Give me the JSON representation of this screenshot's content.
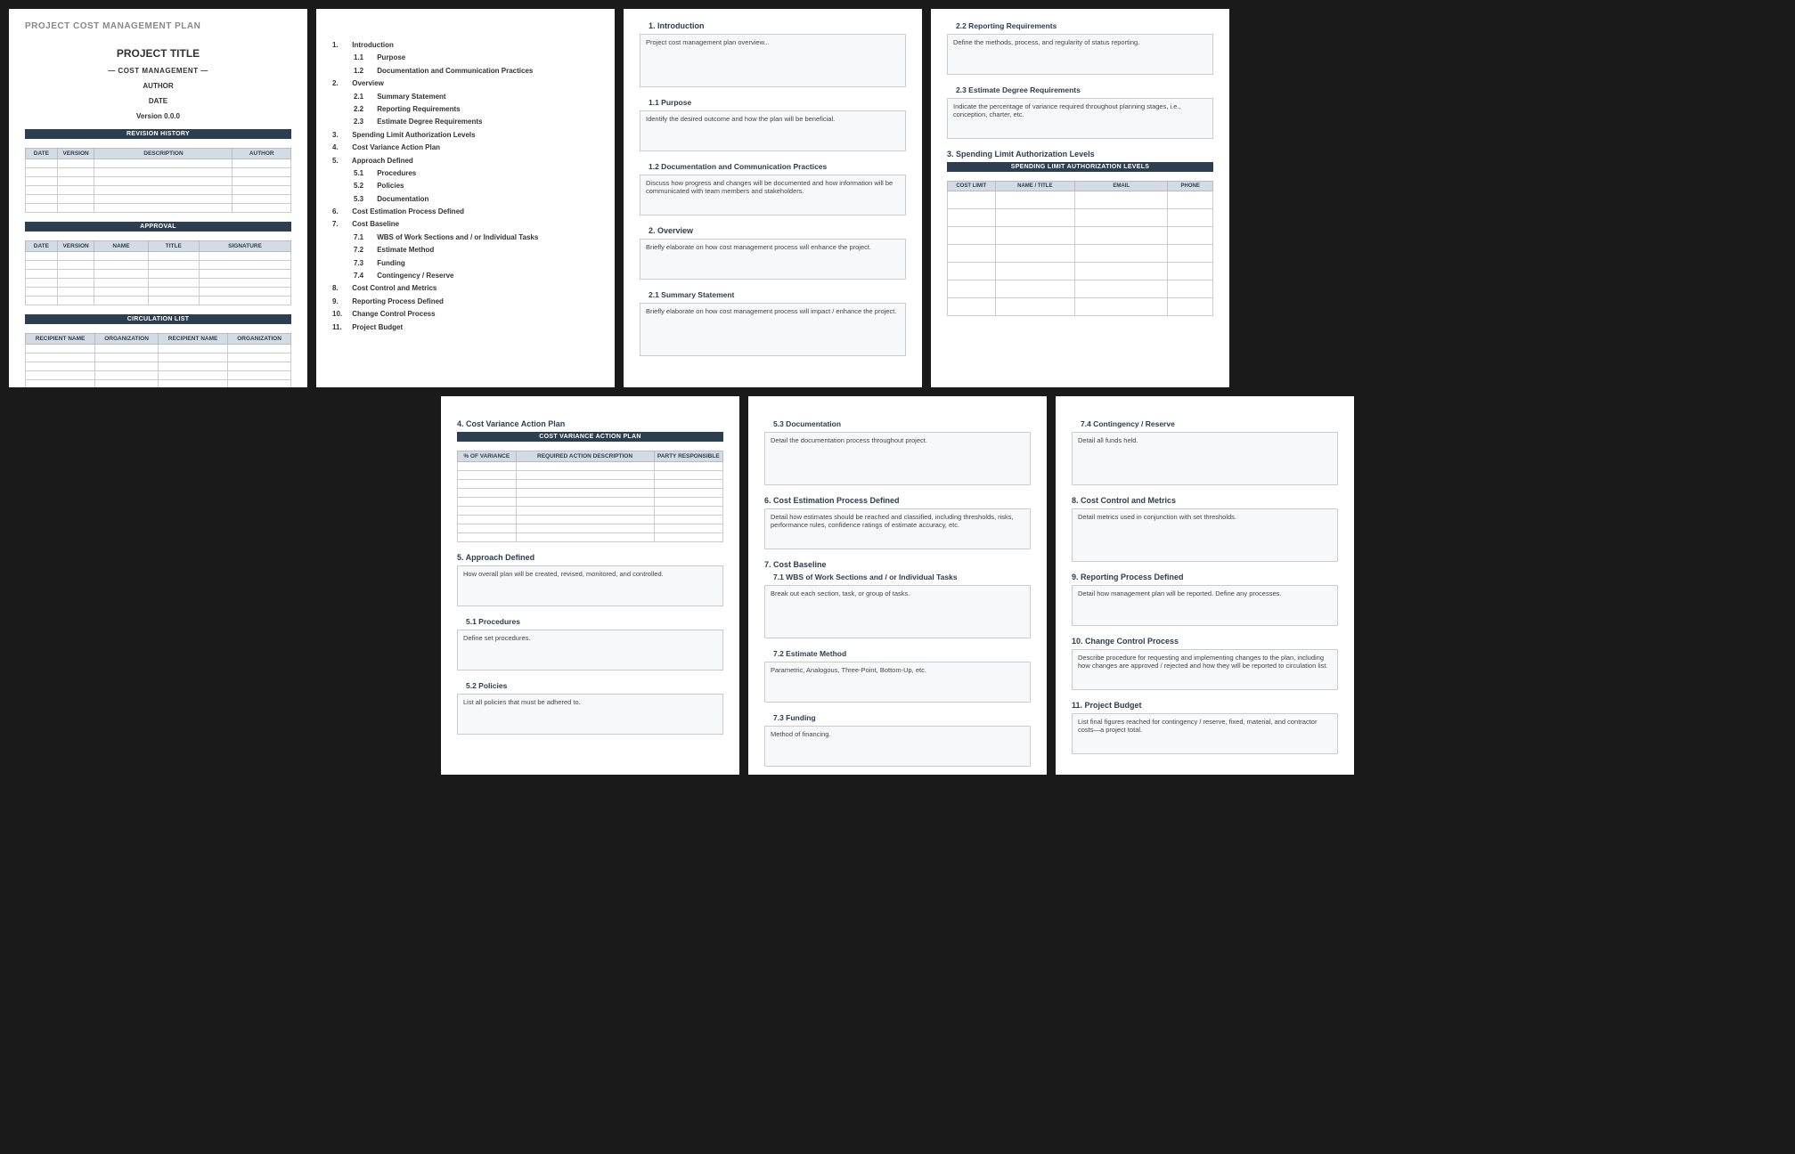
{
  "doc_title": "PROJECT COST MANAGEMENT PLAN",
  "cover": {
    "project_title": "PROJECT TITLE",
    "subtitle": "—   COST MANAGEMENT   —",
    "author": "AUTHOR",
    "date": "DATE",
    "version": "Version 0.0.0"
  },
  "tables": {
    "revision": {
      "title": "REVISION HISTORY",
      "cols": [
        "DATE",
        "VERSION",
        "DESCRIPTION",
        "AUTHOR"
      ]
    },
    "approval": {
      "title": "APPROVAL",
      "cols": [
        "DATE",
        "VERSION",
        "NAME",
        "TITLE",
        "SIGNATURE"
      ]
    },
    "circulation": {
      "title": "CIRCULATION LIST",
      "cols": [
        "RECIPIENT NAME",
        "ORGANIZATION",
        "RECIPIENT NAME",
        "ORGANIZATION"
      ]
    },
    "cvap": {
      "title": "COST VARIANCE ACTION PLAN",
      "cols": [
        "% OF VARIANCE",
        "REQUIRED ACTION DESCRIPTION",
        "PARTY RESPONSIBLE"
      ]
    },
    "spending": {
      "title": "SPENDING LIMIT AUTHORIZATION LEVELS",
      "cols": [
        "COST LIMIT",
        "NAME / TITLE",
        "EMAIL",
        "PHONE"
      ]
    }
  },
  "toc": [
    {
      "n": "1.",
      "t": "Introduction",
      "sub": [
        {
          "n": "1.1",
          "t": "Purpose"
        },
        {
          "n": "1.2",
          "t": "Documentation and Communication Practices"
        }
      ]
    },
    {
      "n": "2.",
      "t": "Overview",
      "sub": [
        {
          "n": "2.1",
          "t": "Summary Statement"
        },
        {
          "n": "2.2",
          "t": "Reporting Requirements"
        },
        {
          "n": "2.3",
          "t": "Estimate Degree Requirements"
        }
      ]
    },
    {
      "n": "3.",
      "t": "Spending Limit Authorization Levels"
    },
    {
      "n": "4.",
      "t": "Cost Variance Action Plan"
    },
    {
      "n": "5.",
      "t": "Approach Defined",
      "sub": [
        {
          "n": "5.1",
          "t": "Procedures"
        },
        {
          "n": "5.2",
          "t": "Policies"
        },
        {
          "n": "5.3",
          "t": "Documentation"
        }
      ]
    },
    {
      "n": "6.",
      "t": "Cost Estimation Process Defined"
    },
    {
      "n": "7.",
      "t": "Cost Baseline",
      "sub": [
        {
          "n": "7.1",
          "t": "WBS of Work Sections and / or Individual Tasks"
        },
        {
          "n": "7.2",
          "t": "Estimate Method"
        },
        {
          "n": "7.3",
          "t": "Funding"
        },
        {
          "n": "7.4",
          "t": "Contingency / Reserve"
        }
      ]
    },
    {
      "n": "8.",
      "t": "Cost Control and Metrics"
    },
    {
      "n": "9.",
      "t": "Reporting Process Defined"
    },
    {
      "n": "10.",
      "t": "Change Control Process"
    },
    {
      "n": "11.",
      "t": "Project Budget"
    }
  ],
  "sections": {
    "s1": {
      "h": "1. Introduction",
      "body": "Project cost management plan overview..."
    },
    "s1_1": {
      "h": "1.1   Purpose",
      "body": "Identify the desired outcome and how the plan will be beneficial."
    },
    "s1_2": {
      "h": "1.2   Documentation and Communication Practices",
      "body": "Discuss how progress and changes will be documented and how information will be communicated with team members and stakeholders."
    },
    "s2": {
      "h": "2. Overview",
      "body": "Briefly elaborate on how cost management process will enhance the project."
    },
    "s2_1": {
      "h": "2.1   Summary Statement",
      "body": "Briefly elaborate on how cost management process will impact / enhance the project."
    },
    "s2_2": {
      "h": "2.2   Reporting Requirements",
      "body": "Define the methods, process, and regularity of status reporting."
    },
    "s2_3": {
      "h": "2.3   Estimate Degree Requirements",
      "body": "Indicate the percentage of variance required throughout planning stages, i.e., conception, charter, etc."
    },
    "s3": {
      "h": "3. Spending Limit Authorization Levels"
    },
    "s4": {
      "h": "4. Cost Variance Action Plan"
    },
    "s5": {
      "h": "5. Approach Defined",
      "body": "How overall plan will be created, revised, monitored, and controlled."
    },
    "s5_1": {
      "h": "5.1   Procedures",
      "body": "Define set procedures."
    },
    "s5_2": {
      "h": "5.2   Policies",
      "body": "List all policies that must be adhered to."
    },
    "s5_3": {
      "h": "5.3   Documentation",
      "body": "Detail the documentation process throughout project."
    },
    "s6": {
      "h": "6. Cost Estimation Process Defined",
      "body": "Detail how estimates should be reached and classified, including thresholds, risks, performance rules, confidence ratings of estimate accuracy, etc."
    },
    "s7": {
      "h": "7. Cost Baseline"
    },
    "s7_1": {
      "h": "7.1   WBS of Work Sections and / or Individual Tasks",
      "body": "Break out each section, task, or group of tasks."
    },
    "s7_2": {
      "h": "7.2   Estimate Method",
      "body": "Parametric, Analogous, Three-Point, Bottom-Up, etc."
    },
    "s7_3": {
      "h": "7.3   Funding",
      "body": "Method of financing."
    },
    "s7_4": {
      "h": "7.4   Contingency / Reserve",
      "body": "Detail all funds held."
    },
    "s8": {
      "h": "8. Cost Control and Metrics",
      "body": "Detail metrics used in conjunction with set thresholds."
    },
    "s9": {
      "h": "9. Reporting Process Defined",
      "body": "Detail how management plan will be reported. Define any processes."
    },
    "s10": {
      "h": "10. Change Control Process",
      "body": "Describe procedure for requesting and implementing changes to the plan, including how changes are approved / rejected and how they will be reported to circulation list."
    },
    "s11": {
      "h": "11. Project Budget",
      "body": "List final figures reached for contingency / reserve, fixed, material, and contractor costs—a project total."
    }
  }
}
